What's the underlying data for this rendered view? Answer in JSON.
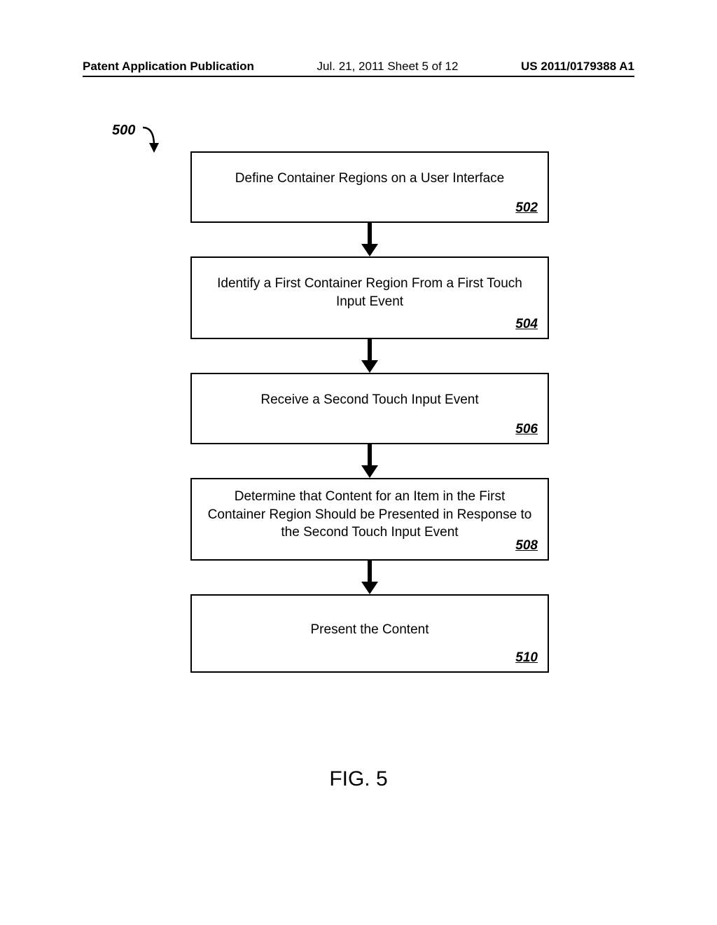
{
  "header": {
    "left": "Patent Application Publication",
    "mid": "Jul. 21, 2011  Sheet 5 of 12",
    "right": "US 2011/0179388 A1"
  },
  "flow": {
    "label": "500",
    "steps": [
      {
        "text": "Define Container Regions on a User Interface",
        "ref": "502"
      },
      {
        "text": "Identify a First Container Region From a First Touch Input Event",
        "ref": "504"
      },
      {
        "text": "Receive a Second Touch Input Event",
        "ref": "506"
      },
      {
        "text": "Determine that Content for an Item in the First Container Region Should be Presented in Response to the Second Touch Input Event",
        "ref": "508"
      },
      {
        "text": "Present the Content",
        "ref": "510"
      }
    ]
  },
  "figure_label": "FIG. 5"
}
